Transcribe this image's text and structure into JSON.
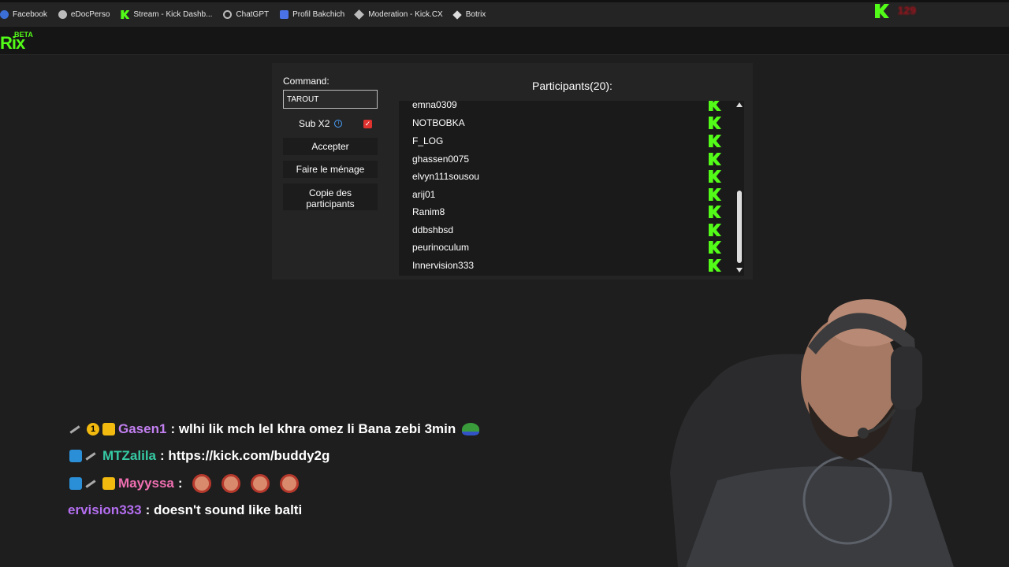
{
  "bookmarks": [
    {
      "label": "Facebook",
      "icon": "facebook-icon"
    },
    {
      "label": "eDocPerso",
      "icon": "globe-icon"
    },
    {
      "label": "Stream - Kick Dashb...",
      "icon": "kick-icon"
    },
    {
      "label": "ChatGPT",
      "icon": "openai-icon"
    },
    {
      "label": "Profil Bakchich",
      "icon": "document-icon"
    },
    {
      "label": "Moderation - Kick.CX",
      "icon": "diamond-icon"
    },
    {
      "label": "Botrix",
      "icon": "botrix-icon"
    }
  ],
  "top": {
    "viewer_count": "129"
  },
  "app": {
    "logo": "Rix",
    "beta": "BETA"
  },
  "panel": {
    "command_label": "Command:",
    "command_value": "TAROUT",
    "sub_label": "Sub X2",
    "sub_checked": true,
    "accept_label": "Accepter",
    "clean_label": "Faire le ménage",
    "copy_label_1": "Copie des",
    "copy_label_2": "participants",
    "participants_title": "Participants(20):",
    "participants": [
      "emna0309",
      "NOTBOBKA",
      "F_LOG",
      "ghassen0075",
      "elvyn111sousou",
      "arij01",
      "Ranim8",
      "ddbshbsd",
      "peurinoculum",
      "Innervision333"
    ]
  },
  "chat": [
    {
      "user": "Gasen1",
      "user_color": "#c27ff0",
      "text": ": wlhi lik mch lel khra omez li Bana zebi 3min"
    },
    {
      "user": "MTZalila",
      "user_color": "#36c9a3",
      "text": ": https://kick.com/buddy2g"
    },
    {
      "user": "Mayyssa",
      "user_color": "#f06fb1",
      "text": ":"
    },
    {
      "user": "ervision333",
      "user_color": "#b46ef0",
      "text": ": doesn't sound like balti"
    }
  ],
  "colors": {
    "accent": "#53fc18",
    "danger": "#e0322f"
  }
}
